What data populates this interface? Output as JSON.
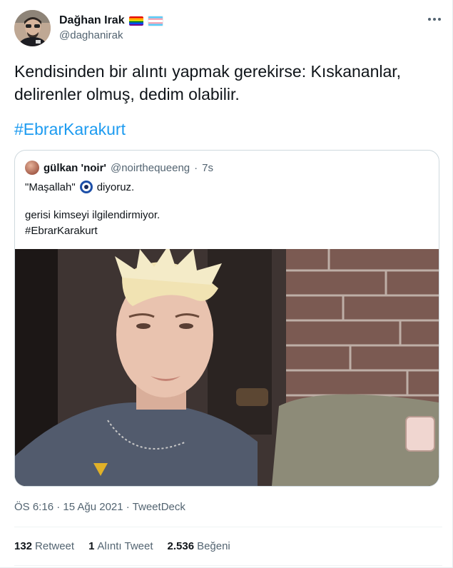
{
  "author": {
    "display_name": "Dağhan Irak",
    "handle": "@daghanirak",
    "badges": [
      "rainbow-flag",
      "transgender-flag"
    ]
  },
  "tweet": {
    "text": "Kendisinden bir alıntı yapmak gerekirse: Kıskananlar, delirenler olmuş, dedim olabilir.",
    "hashtag": "#EbrarKarakurt"
  },
  "quoted": {
    "display_name": "gülkan 'noir'",
    "handle": "@noirthequeeng",
    "separator": "·",
    "time": "7s",
    "line1_a": "\"Maşallah\"",
    "line1_icon": "nazar-evil-eye-icon",
    "line1_b": "diyoruz.",
    "line2": "gerisi kimseyi ilgilendirmiyor.",
    "line3": "#EbrarKarakurt"
  },
  "meta": {
    "timestamp": "ÖS 6:16 · 15 Ağu 2021 · TweetDeck"
  },
  "stats": [
    {
      "count": "132",
      "label": "Retweet"
    },
    {
      "count": "1",
      "label": "Alıntı Tweet"
    },
    {
      "count": "2.536",
      "label": "Beğeni"
    }
  ],
  "colors": {
    "link": "#1d9bf0",
    "secondary_text": "#536471",
    "border": "#cfd9de"
  }
}
